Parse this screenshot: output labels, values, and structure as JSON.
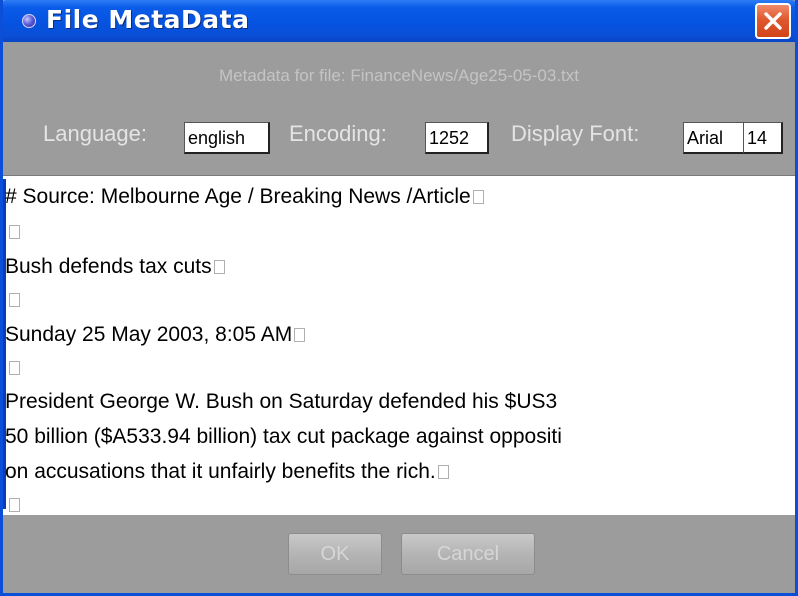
{
  "window": {
    "title": "File MetaData",
    "caption": "Metadata for file: FinanceNews/Age25-05-03.txt"
  },
  "settings": {
    "language_label": "Language:",
    "language_value": "english",
    "encoding_label": "Encoding:",
    "encoding_value": "1252",
    "font_label": "Display Font:",
    "font_name": "Arial",
    "font_size": "14"
  },
  "content": {
    "lines": [
      "# Source: Melbourne Age / Breaking News /Article",
      "",
      "Bush defends tax cuts",
      "",
      "Sunday 25 May 2003, 8:05 AM",
      "",
      "President George W. Bush on Saturday defended his $US3",
      "50 billion ($A533.94 billion) tax cut package against oppositi",
      "on accusations that it unfairly benefits the rich.",
      ""
    ]
  },
  "buttons": {
    "ok_label": "OK",
    "cancel_label": "Cancel"
  },
  "icons": {
    "title_icon": "circle-dot-icon",
    "close_icon": "close-icon"
  },
  "colors": {
    "titlebar": "#0553e0",
    "close_button": "#e0582f",
    "body": "#9c9c9c"
  }
}
